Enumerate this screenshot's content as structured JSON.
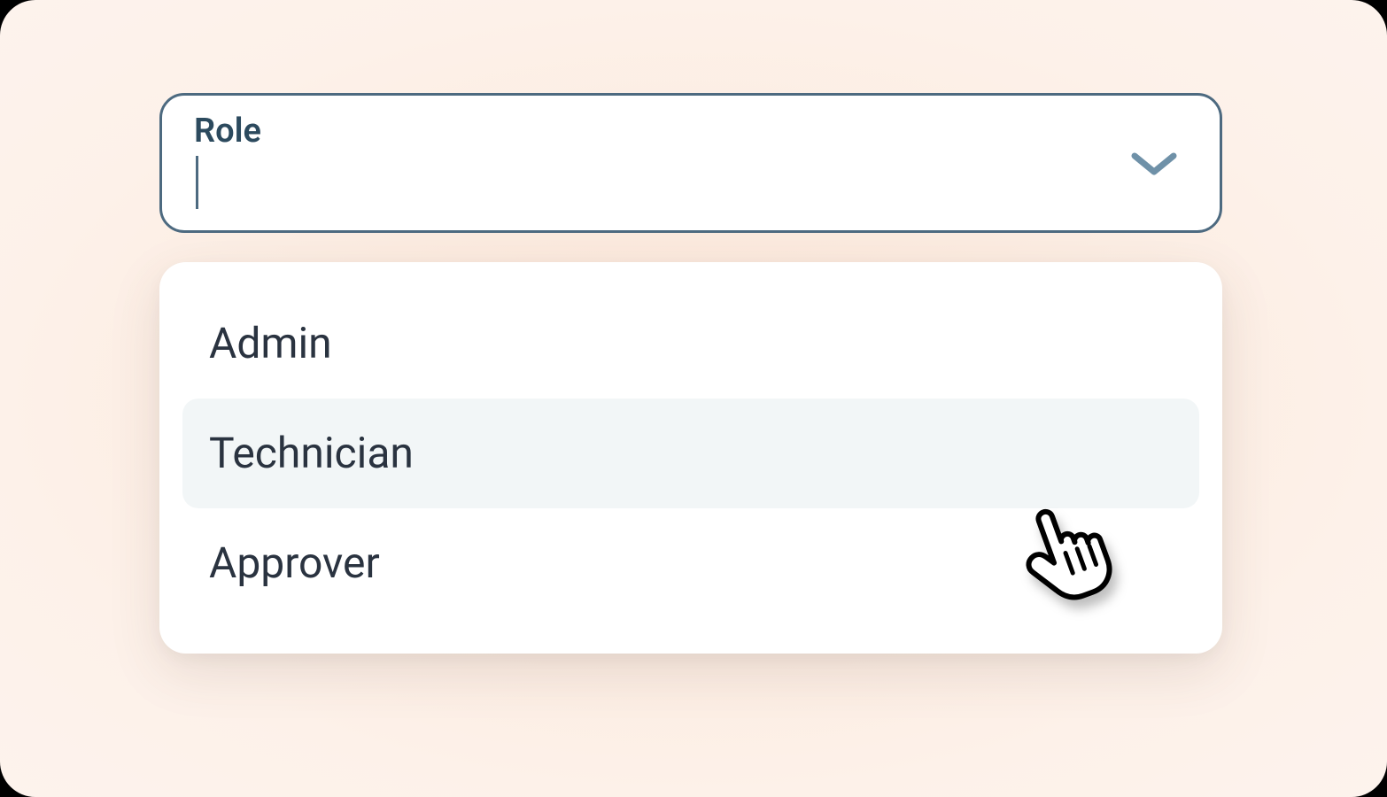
{
  "dropdown": {
    "label": "Role",
    "value": "",
    "border_color": "#4D6A80",
    "options": [
      {
        "label": "Admin",
        "hovered": false
      },
      {
        "label": "Technician",
        "hovered": true
      },
      {
        "label": "Approver",
        "hovered": false
      }
    ]
  },
  "icons": {
    "chevron": "chevron-down-icon",
    "cursor": "pointer-hand-icon"
  },
  "background_color": "#FCECE1"
}
